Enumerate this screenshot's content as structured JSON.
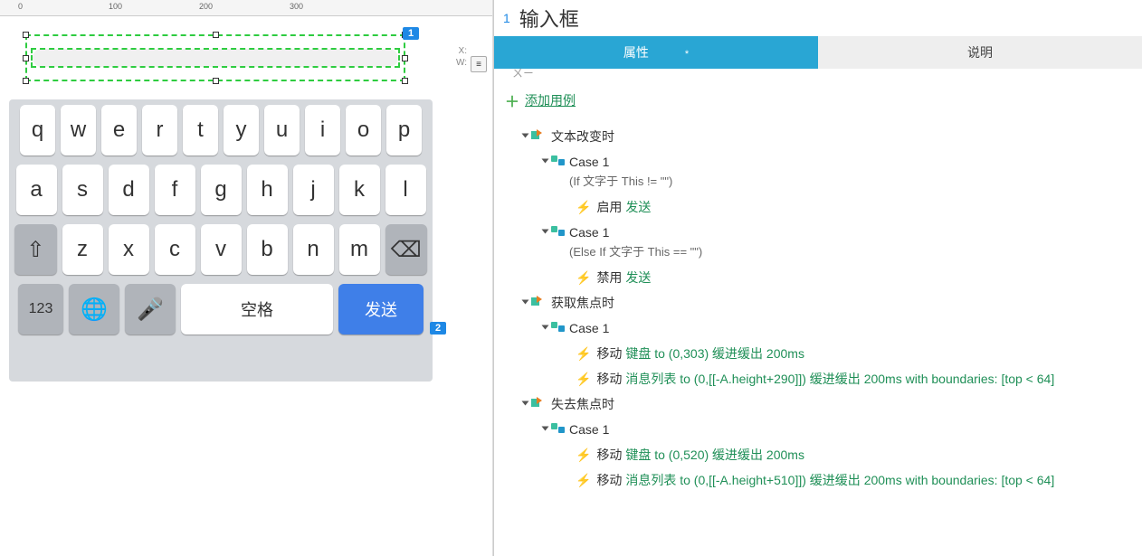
{
  "ruler": {
    "m0": "0",
    "m100": "100",
    "m200": "200",
    "m300": "300"
  },
  "badges": {
    "b1": "1",
    "b2": "2"
  },
  "posInfo": {
    "x": "X:",
    "w": "W:"
  },
  "keyboard": {
    "row1": [
      "q",
      "w",
      "e",
      "r",
      "t",
      "y",
      "u",
      "i",
      "o",
      "p"
    ],
    "row2": [
      "a",
      "s",
      "d",
      "f",
      "g",
      "h",
      "j",
      "k",
      "l"
    ],
    "row3": [
      "z",
      "x",
      "c",
      "v",
      "b",
      "n",
      "m"
    ],
    "shift": "⇧",
    "back": "⌫",
    "num": "123",
    "globe": "🌐",
    "mic": "🎤",
    "space": "空格",
    "send": "发送"
  },
  "title": {
    "num": "1",
    "text": "输入框"
  },
  "tabs": {
    "prop": "属性",
    "star": "*",
    "desc": "说明"
  },
  "addCase": "添加用例",
  "truncTop": "ㄨㄧ",
  "events": {
    "textChange": {
      "label": "文本改变时",
      "case1": {
        "name": "Case 1",
        "cond": "(If 文字于 This != \"\")",
        "action1_pre": "启用 ",
        "action1_tgt": "发送"
      },
      "case2": {
        "name": "Case 1",
        "cond": "(Else If 文字于 This == \"\")",
        "action1_pre": "禁用 ",
        "action1_tgt": "发送"
      }
    },
    "gotFocus": {
      "label": "获取焦点时",
      "case1": {
        "name": "Case 1",
        "a1_pre": "移动 ",
        "a1_tgt": "键盘 to (0,303) 缓进缓出 200ms",
        "a2_pre": "移动 ",
        "a2_tgt": "消息列表 to (0,[[-A.height+290]]) 缓进缓出 200ms with boundaries: [top < 64]"
      }
    },
    "lostFocus": {
      "label": "失去焦点时",
      "case1": {
        "name": "Case 1",
        "a1_pre": "移动 ",
        "a1_tgt": "键盘 to (0,520) 缓进缓出 200ms",
        "a2_pre": "移动 ",
        "a2_tgt": "消息列表 to (0,[[-A.height+510]]) 缓进缓出 200ms with boundaries: [top < 64]"
      }
    }
  }
}
